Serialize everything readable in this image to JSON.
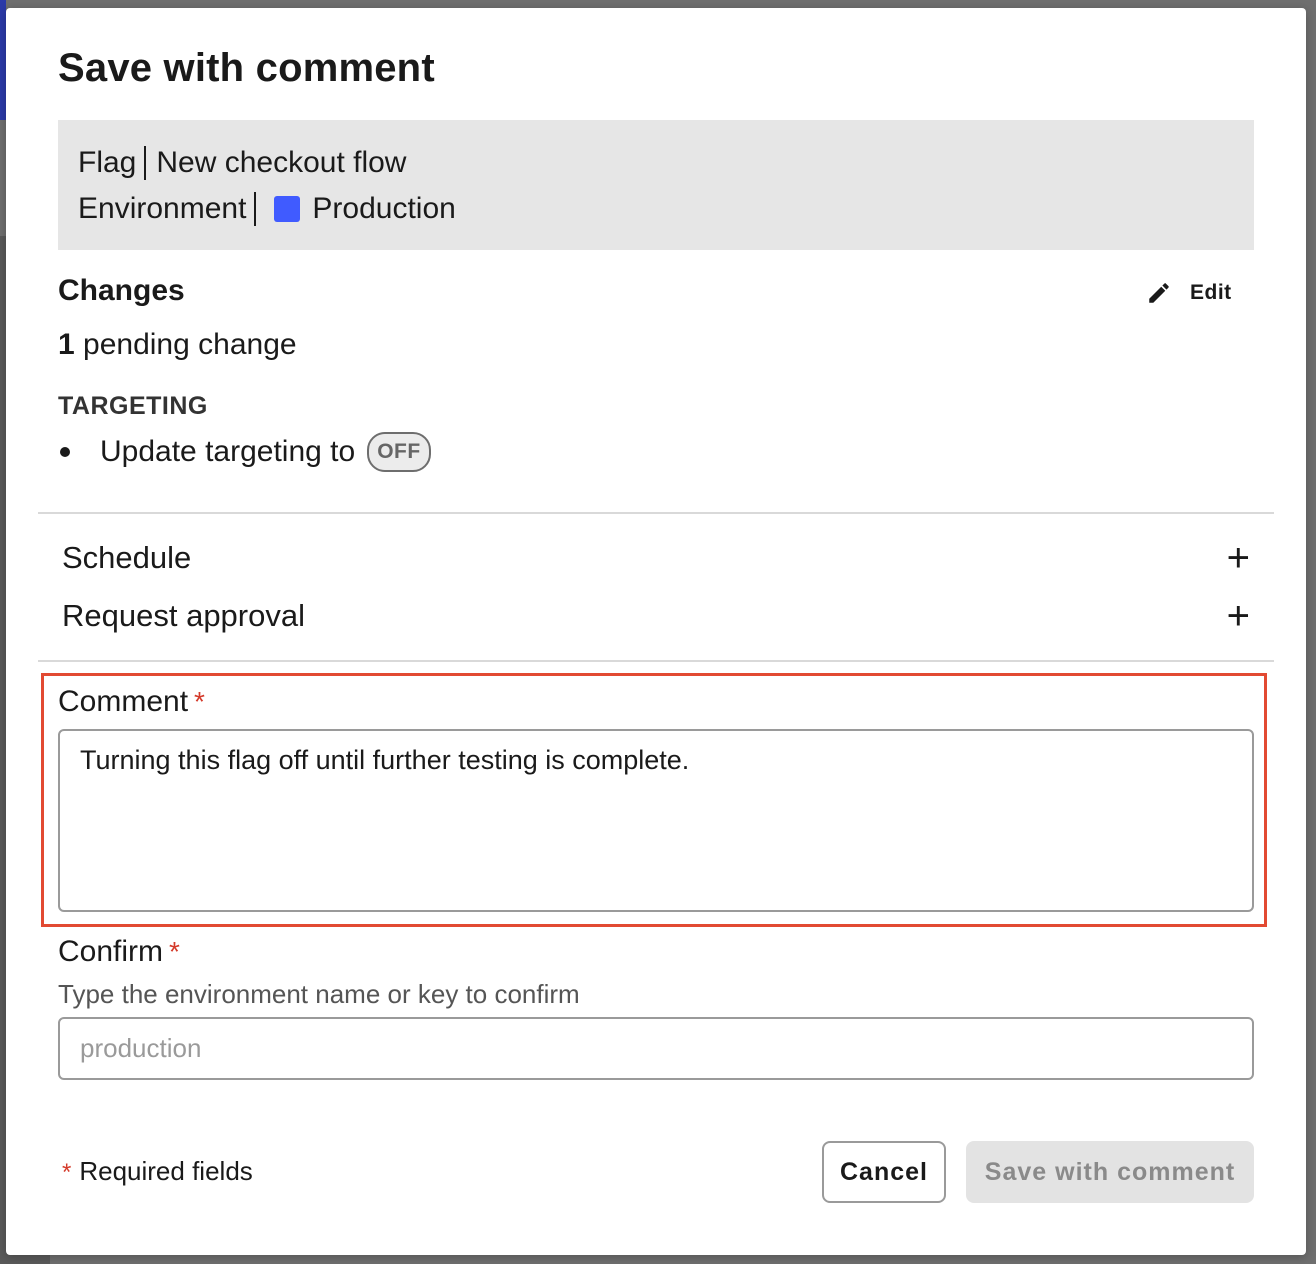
{
  "modal": {
    "title": "Save with comment",
    "info": {
      "flag_label": "Flag",
      "flag_name": "New checkout flow",
      "env_label": "Environment",
      "env_name": "Production",
      "env_color": "#405bff"
    },
    "changes": {
      "title": "Changes",
      "edit_label": "Edit",
      "pending_count": "1",
      "pending_text": "pending change",
      "targeting_label": "TARGETING",
      "item_text": "Update targeting to",
      "item_value": "OFF"
    },
    "sections": {
      "schedule": "Schedule",
      "request_approval": "Request approval"
    },
    "comment": {
      "label": "Comment",
      "required_mark": "*",
      "value": "Turning this flag off until further testing is complete."
    },
    "confirm": {
      "label": "Confirm",
      "required_mark": "*",
      "helper": "Type the environment name or key to confirm",
      "placeholder": "production"
    },
    "footer": {
      "required_mark": "*",
      "required_note": "Required fields",
      "cancel_label": "Cancel",
      "save_label": "Save with comment"
    }
  }
}
